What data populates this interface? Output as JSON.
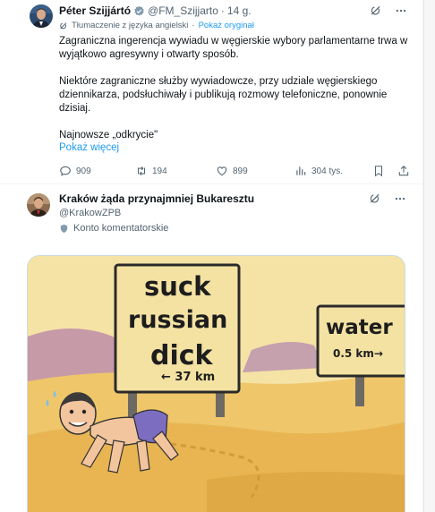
{
  "tweet1": {
    "author_name": "Péter Szijjártó",
    "handle": "@FM_Szijjarto",
    "separator": "·",
    "time": "14 g.",
    "translated_label": "Tłumaczenie z języka angielski",
    "show_original": "Pokaż oryginał",
    "paragraph1": "Zagraniczna ingerencja wywiadu w węgierskie wybory parlamentarne trwa w wyjątkowo agresywny i otwarty sposób.",
    "paragraph2": "Niektóre zagraniczne służby wywiadowcze, przy udziale węgierskiego dziennikarza, podsłuchiwały i publikują rozmowy telefoniczne, ponownie dzisiaj.",
    "paragraph3": "Najnowsze „odkrycie\"",
    "show_more": "Pokaż więcej",
    "replies": "909",
    "reposts": "194",
    "likes": "899",
    "views": "304 tys."
  },
  "tweet2": {
    "author_name": "Kraków żąda przynajmniej Bukaresztu",
    "handle": "@KrakowZPB",
    "account_label": "Konto komentatorskie"
  },
  "media": {
    "sign_left_line1": "suck",
    "sign_left_line2": "russian",
    "sign_left_line3": "dick",
    "sign_left_distance": "← 37 km",
    "sign_right_line1": "water",
    "sign_right_distance": "0.5 km→"
  },
  "icons": {
    "grok": "grok-icon",
    "more": "more-icon",
    "reply": "reply-icon",
    "repost": "repost-icon",
    "like": "heart-icon",
    "views": "views-icon",
    "bookmark": "bookmark-icon",
    "share": "share-icon",
    "verified": "verified-badge-icon",
    "shield": "shield-icon"
  },
  "colors": {
    "link": "#1d9bf0",
    "secondary_text": "#536471",
    "text": "#0f1419"
  }
}
